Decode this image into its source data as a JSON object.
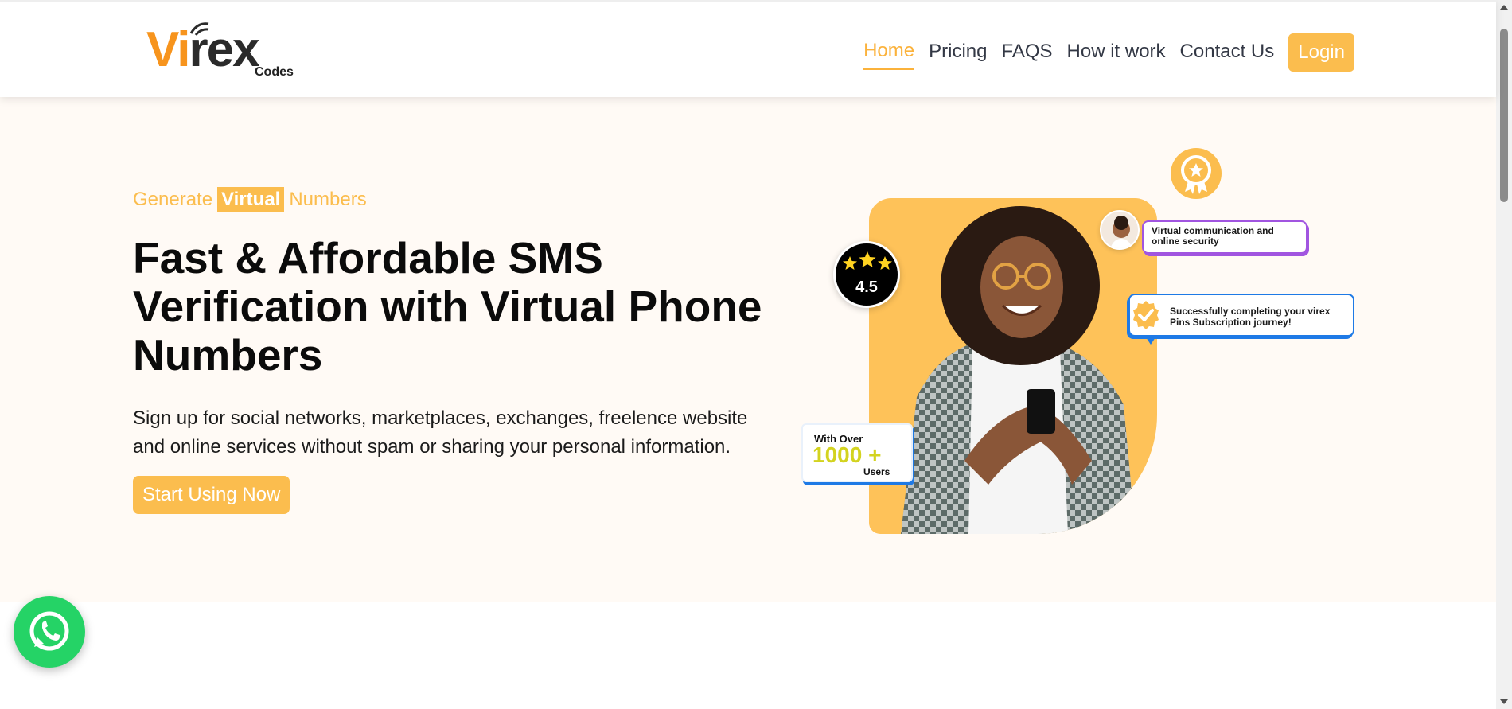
{
  "brand": {
    "logo_text": "Virex",
    "logo_sub": "Codes",
    "accent": "#fbbd4e",
    "logo_orange": "#f7941d"
  },
  "nav": {
    "items": [
      {
        "label": "Home",
        "active": true
      },
      {
        "label": "Pricing"
      },
      {
        "label": "FAQS"
      },
      {
        "label": "How it work"
      },
      {
        "label": "Contact Us"
      }
    ],
    "login": "Login"
  },
  "hero": {
    "eyebrow_pre": "Generate",
    "eyebrow_highlight": "Virtual",
    "eyebrow_post": "Numbers",
    "headline": "Fast & Affordable SMS Verification with Virtual Phone Numbers",
    "subtext": "Sign up for social networks, marketplaces, exchanges, freelence website and online services without spam or sharing your personal information.",
    "cta": "Start Using Now"
  },
  "illustration": {
    "rating": "4.5",
    "stars": 3,
    "bubble_1": "Virtual communication and online security",
    "bubble_2": "Successfully completing your virex Pins Subscription journey!",
    "users_line1": "With Over",
    "users_line2": "1000 +",
    "users_line3": "Users",
    "icons": [
      "award-icon",
      "star-icon",
      "check-badge-icon",
      "avatar-image",
      "woman-with-phone-image"
    ]
  },
  "floating": {
    "whatsapp_icon": "whatsapp-icon",
    "whatsapp_color": "#25d366"
  }
}
